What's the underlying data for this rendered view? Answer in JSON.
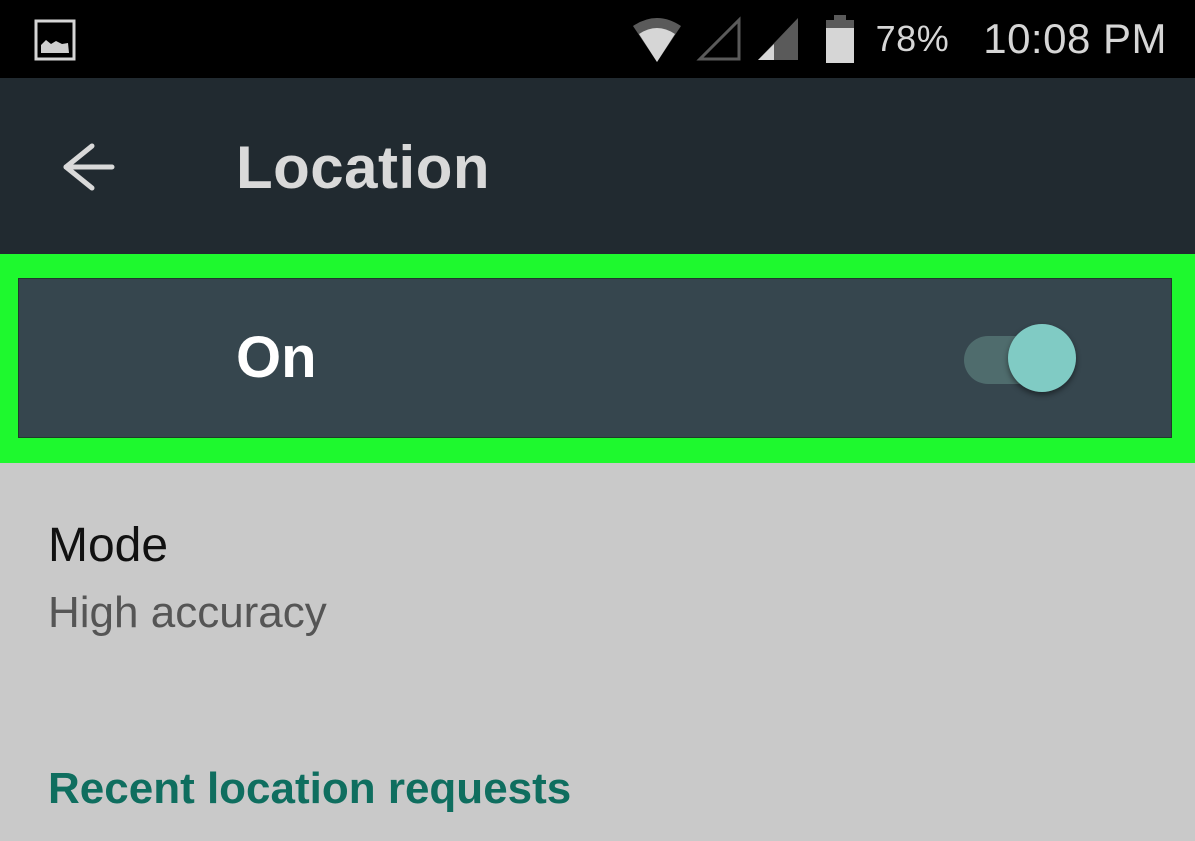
{
  "status_bar": {
    "left_icon": "image-notification-icon",
    "icons": [
      "wifi-icon",
      "cell-signal-empty-icon",
      "cell-signal-partial-icon",
      "battery-icon"
    ],
    "battery_percent": "78%",
    "time": "10:08 PM"
  },
  "app_bar": {
    "back_icon": "arrow-left-icon",
    "title": "Location"
  },
  "master_switch": {
    "label": "On",
    "checked": true,
    "highlight_color": "#1ef92e",
    "accent_color": "#80cbc4"
  },
  "settings": [
    {
      "title": "Mode",
      "summary": "High accuracy"
    }
  ],
  "section_header": "Recent location requests",
  "colors": {
    "app_bar": "#212a30",
    "master_row": "#36464e",
    "body": "#c9c9c9",
    "section_header": "#0f6e5f"
  }
}
